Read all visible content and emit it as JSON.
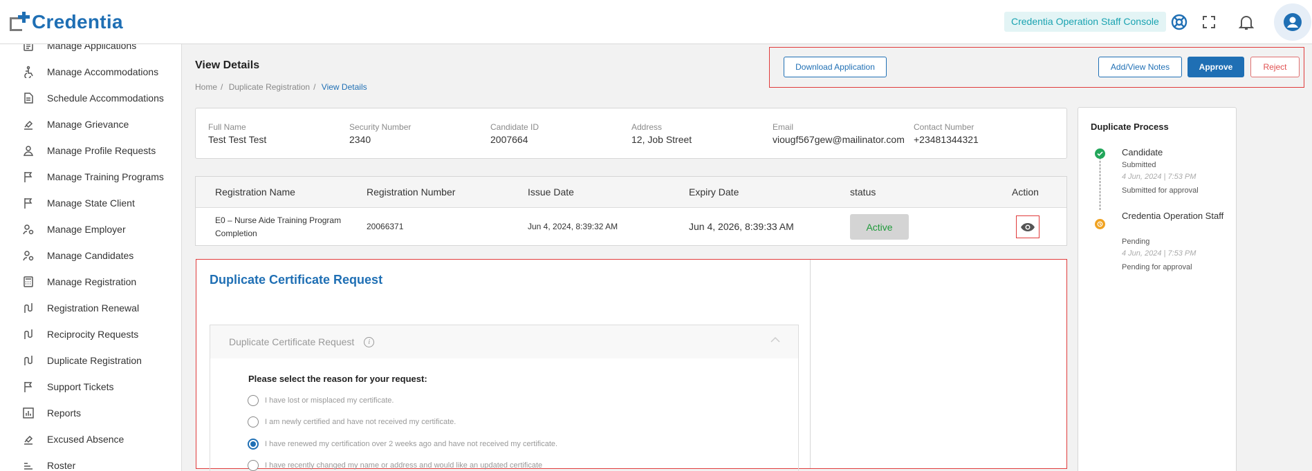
{
  "header": {
    "brand": "Credentia",
    "console_label": "Credentia Operation Staff Console",
    "icons": [
      "support-icon",
      "fullscreen-icon",
      "bell-icon",
      "account-icon"
    ]
  },
  "sidebar": {
    "items": [
      {
        "label": "Manage Applications",
        "icon": "document-icon"
      },
      {
        "label": "Manage Accommodations",
        "icon": "accessibility-icon"
      },
      {
        "label": "Schedule Accommodations",
        "icon": "document-icon"
      },
      {
        "label": "Manage Grievance",
        "icon": "gavel-icon"
      },
      {
        "label": "Manage Profile Requests",
        "icon": "person-icon"
      },
      {
        "label": "Manage Training Programs",
        "icon": "flag-icon"
      },
      {
        "label": "Manage State Client",
        "icon": "flag-icon"
      },
      {
        "label": "Manage Employer",
        "icon": "user-gear-icon"
      },
      {
        "label": "Manage Candidates",
        "icon": "user-gear-icon"
      },
      {
        "label": "Manage Registration",
        "icon": "calculator-icon"
      },
      {
        "label": "Registration Renewal",
        "icon": "route-icon"
      },
      {
        "label": "Reciprocity Requests",
        "icon": "route-icon"
      },
      {
        "label": "Duplicate Registration",
        "icon": "route-icon"
      },
      {
        "label": "Support Tickets",
        "icon": "flag-icon"
      },
      {
        "label": "Reports",
        "icon": "chart-icon"
      },
      {
        "label": "Excused Absence",
        "icon": "gavel-icon"
      },
      {
        "label": "Roster",
        "icon": "roster-icon"
      }
    ]
  },
  "page": {
    "title": "View Details",
    "breadcrumb": [
      "Home",
      "Duplicate Registration",
      "View Details"
    ]
  },
  "actions": {
    "download": "Download Application",
    "notes": "Add/View Notes",
    "approve": "Approve",
    "reject": "Reject"
  },
  "candidate": {
    "fields": [
      {
        "label": "Full Name",
        "value": "Test Test Test"
      },
      {
        "label": "Security Number",
        "value": "2340"
      },
      {
        "label": "Candidate ID",
        "value": "2007664"
      },
      {
        "label": "Address",
        "value": "12, Job Street"
      },
      {
        "label": "Email",
        "value": "viougf567gew@mailinator.com"
      },
      {
        "label": "Contact Number",
        "value": "+23481344321"
      }
    ]
  },
  "registration_table": {
    "headers": [
      "Registration Name",
      "Registration Number",
      "Issue Date",
      "Expiry Date",
      "status",
      "Action"
    ],
    "row": {
      "name_line1": "E0 – Nurse Aide Training Program",
      "name_line2": "Completion",
      "number": "20066371",
      "issue_date": "Jun 4, 2024, 8:39:32 AM",
      "expiry_date": "Jun 4, 2026, 8:39:33 AM",
      "status": "Active"
    }
  },
  "duplicate_request": {
    "title": "Duplicate Certificate Request",
    "accordion_title": "Duplicate Certificate Request",
    "info_glyph": "i",
    "question": "Please select the reason for your request:",
    "options": [
      "I have lost or misplaced my certificate.",
      "I am newly certified and have not received my certificate.",
      "I have renewed my certification over 2 weeks ago and have not received my certificate.",
      "I have recently changed my name or address and would like an updated certificate"
    ],
    "selected_index": 2
  },
  "process": {
    "title": "Duplicate Process",
    "steps": [
      {
        "name": "Candidate",
        "status": "Submitted",
        "time": "4 Jun, 2024 | 7:53 PM",
        "note": "Submitted for approval",
        "color": "#22a65a"
      },
      {
        "name": "Credentia Operation Staff",
        "status": "Pending",
        "time": "4 Jun, 2024 | 7:53 PM",
        "note": "Pending for approval",
        "color": "#f0a323"
      }
    ]
  }
}
